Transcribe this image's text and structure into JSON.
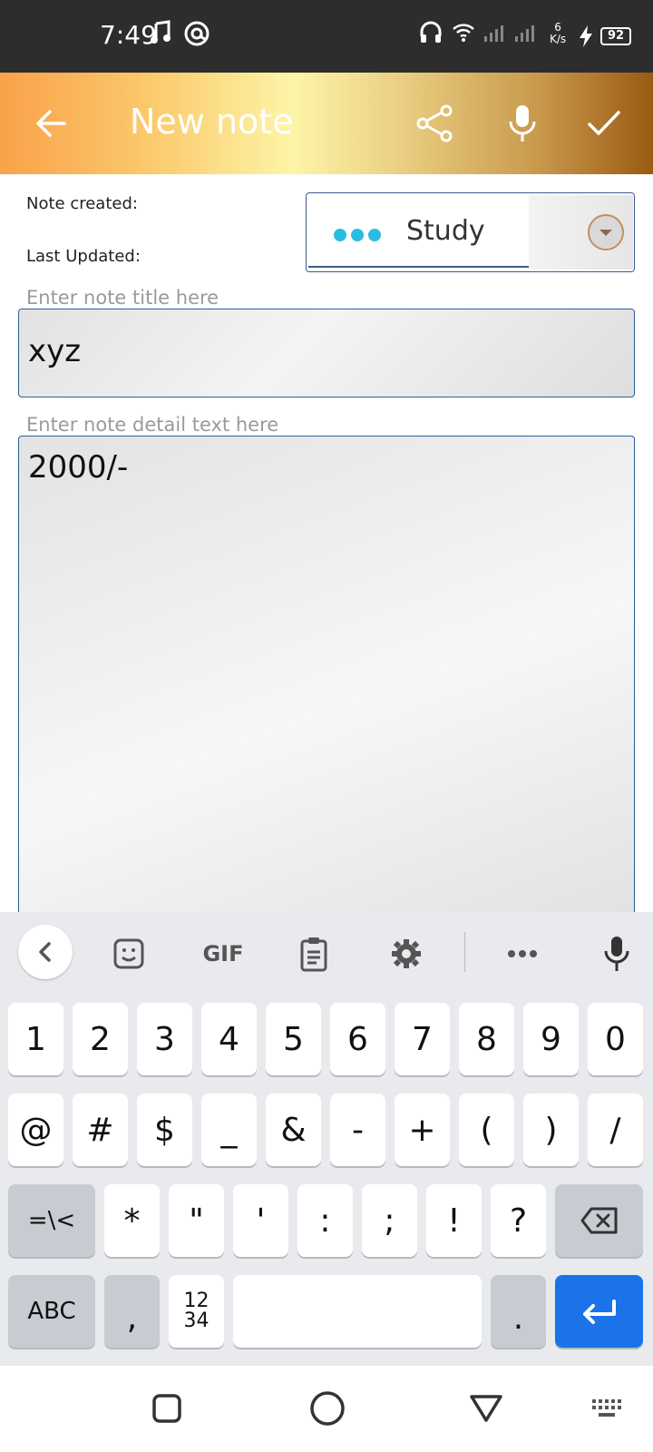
{
  "status_bar": {
    "time": "7:49",
    "speed_value": "6",
    "speed_unit": "K/s",
    "battery": "92"
  },
  "app_bar": {
    "title": "New note"
  },
  "meta": {
    "created_label": "Note created:",
    "updated_label": "Last Updated:"
  },
  "category": {
    "selected": "Study",
    "dot_color": "#2bbce3"
  },
  "title_field": {
    "hint": "Enter note title here",
    "value": "xyz"
  },
  "detail_field": {
    "hint": "Enter note detail text here",
    "value": "2000/-"
  },
  "keyboard": {
    "toolbar": {
      "gif_label": "GIF"
    },
    "row1": [
      "1",
      "2",
      "3",
      "4",
      "5",
      "6",
      "7",
      "8",
      "9",
      "0"
    ],
    "row2": [
      "@",
      "#",
      "$",
      "_",
      "&",
      "-",
      "+",
      "(",
      ")",
      "/"
    ],
    "row3": [
      "*",
      "\"",
      "'",
      ":",
      ";",
      "!",
      "?"
    ],
    "symbols_toggle": "=\\<",
    "abc_label": "ABC",
    "comma": ",",
    "numpad_top": "12",
    "numpad_bottom": "34",
    "period": ".",
    "enter_color": "#1a73e8"
  }
}
